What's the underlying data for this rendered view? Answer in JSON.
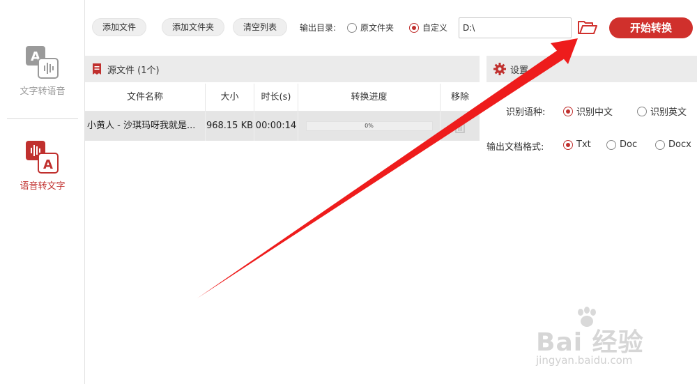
{
  "sidebar": {
    "items": [
      {
        "label": "文字转语音",
        "active": false
      },
      {
        "label": "语音转文字",
        "active": true
      }
    ]
  },
  "toolbar": {
    "add_file": "添加文件",
    "add_folder": "添加文件夹",
    "clear_list": "清空列表",
    "output_dir_label": "输出目录:",
    "opt_source_folder": "原文件夹",
    "opt_custom": "自定义",
    "path_value": "D:\\",
    "start_button": "开始转换"
  },
  "source_panel": {
    "title": "源文件 (1个)",
    "columns": [
      "文件名称",
      "大小",
      "时长(s)",
      "转换进度",
      "移除"
    ],
    "rows": [
      {
        "name": "小黄人 - 沙琪玛呀我就是...",
        "size": "968.15 KB",
        "duration": "00:00:14",
        "progress": "0%",
        "progress_value": 0
      }
    ]
  },
  "settings_panel": {
    "title": "设置",
    "lang_label": "识别语种:",
    "lang_options": [
      "识别中文",
      "识别英文"
    ],
    "lang_selected": "识别中文",
    "format_label": "输出文档格式:",
    "format_options": [
      "Txt",
      "Doc",
      "Docx"
    ],
    "format_selected": "Txt"
  },
  "watermark": {
    "brand": "Bai 经验",
    "url": "jingyan.baidu.com"
  },
  "colors": {
    "accent": "#d0302c",
    "header_bg": "#ebebeb",
    "row_bg": "#e5e5e5"
  }
}
